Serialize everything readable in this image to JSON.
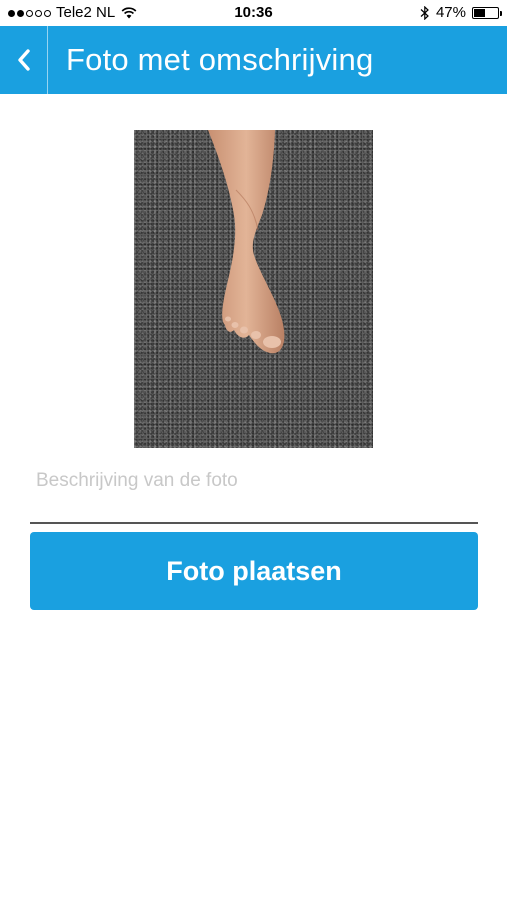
{
  "status_bar": {
    "carrier": "Tele2 NL",
    "time": "10:36",
    "battery_percent": "47%",
    "battery_level": 0.47,
    "signal_strength": 2,
    "signal_max": 5
  },
  "nav": {
    "title": "Foto met omschrijving",
    "back_icon": "chevron-left-icon"
  },
  "photo": {
    "alt": "Foto van een voet"
  },
  "description": {
    "placeholder": "Beschrijving van de foto",
    "value": ""
  },
  "actions": {
    "post_label": "Foto plaatsen"
  },
  "colors": {
    "accent": "#1aa0e0"
  }
}
